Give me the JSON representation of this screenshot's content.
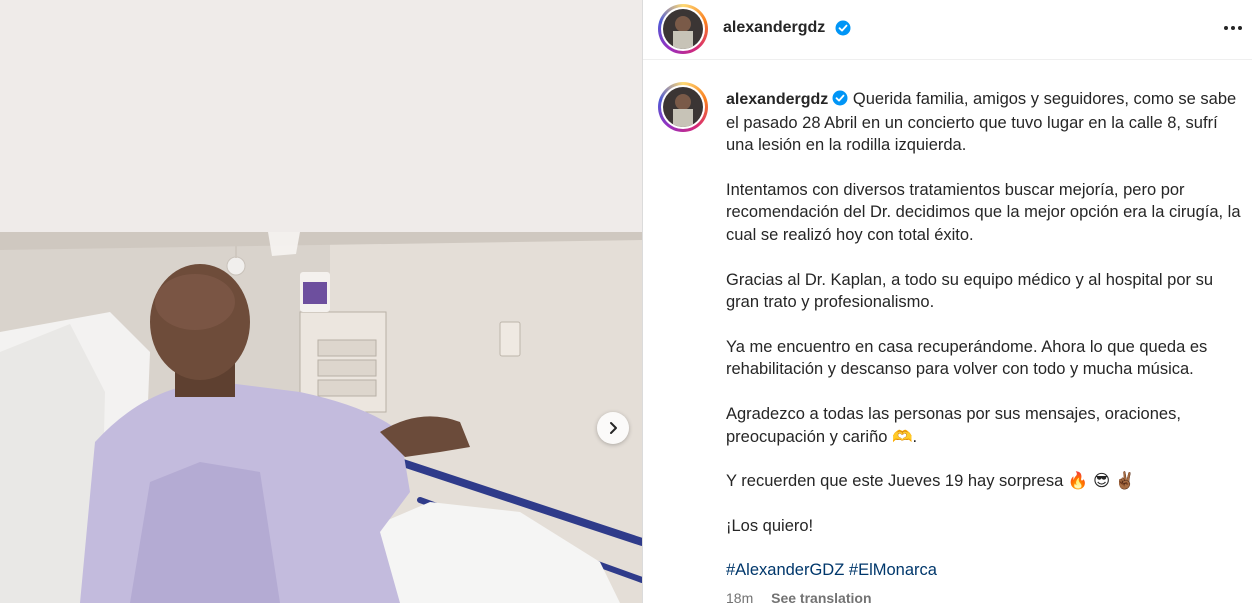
{
  "post": {
    "username": "alexandergdz",
    "verified_icon": "verified-badge-icon",
    "more_icon": "more-options-icon",
    "next_icon": "chevron-right-icon",
    "caption": [
      "Querida familia, amigos y seguidores, como se sabe el pasado 28 Abril en un concierto que tuvo lugar en la calle 8, sufrí una lesión en la rodilla izquierda.",
      "Intentamos con diversos tratamientos buscar mejoría, pero por recomendación del Dr. decidimos que la mejor opción era la cirugía, la cual se realizó hoy con total éxito.",
      "Gracias al Dr. Kaplan, a todo su equipo médico y al hospital por su gran trato y profesionalismo.",
      "Ya me encuentro en casa recuperándome. Ahora lo que queda es rehabilitación y descanso para volver con todo y mucha música.",
      "Agradezco a todas las personas por sus mensajes, oraciones, preocupación y cariño 🫶.",
      "Y recuerden que este Jueves 19 hay sorpresa 🔥 😎 ✌🏾",
      "¡Los quiero!"
    ],
    "hashtags": [
      "#AlexanderGDZ",
      "#ElMonarca"
    ],
    "time_ago": "18m",
    "see_translation": "See translation"
  },
  "colors": {
    "verified_blue": "#0095f6",
    "hashtag": "#00376b",
    "gown": "#c3bbdd",
    "media_bg": "#efebe9"
  }
}
